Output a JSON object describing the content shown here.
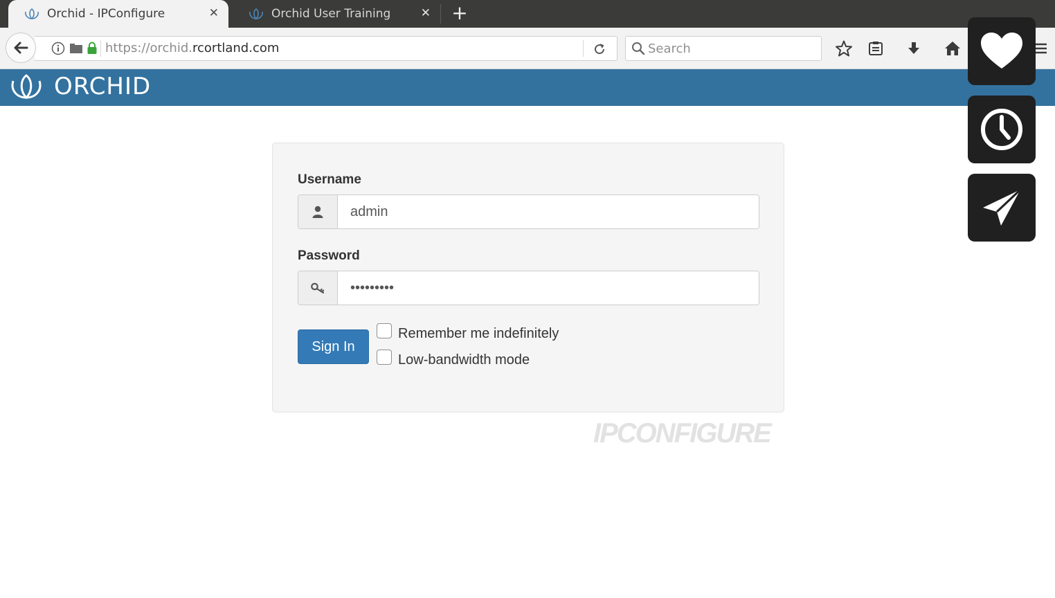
{
  "browser": {
    "tabs": [
      {
        "title": "Orchid - IPConfigure",
        "active": true
      },
      {
        "title": "Orchid User Training",
        "active": false
      }
    ],
    "new_tab_label": "+",
    "close_label": "✕",
    "url": {
      "prefix": "https://orchid.",
      "host": "rcortland.com"
    },
    "search_placeholder": "Search",
    "icons": [
      "back-arrow-icon",
      "info-icon",
      "folder-icon",
      "lock-icon",
      "reload-icon",
      "search-icon",
      "star-icon",
      "reader-icon",
      "download-icon",
      "home-icon",
      "menu-icon"
    ]
  },
  "header": {
    "logo_text": "ORCHID",
    "color": "#33729f"
  },
  "login": {
    "username_label": "Username",
    "username_value": "admin",
    "password_label": "Password",
    "password_value": "•••••••••",
    "signin_label": "Sign In",
    "remember_label": "Remember me indefinitely",
    "remember_checked": false,
    "lowbw_label": "Low-bandwidth mode",
    "lowbw_checked": false,
    "accent_color": "#337ab7"
  },
  "brand_watermark": "IPCONFIGURE",
  "side_buttons": [
    {
      "icon": "heart-icon"
    },
    {
      "icon": "clock-icon"
    },
    {
      "icon": "paper-plane-icon"
    }
  ]
}
